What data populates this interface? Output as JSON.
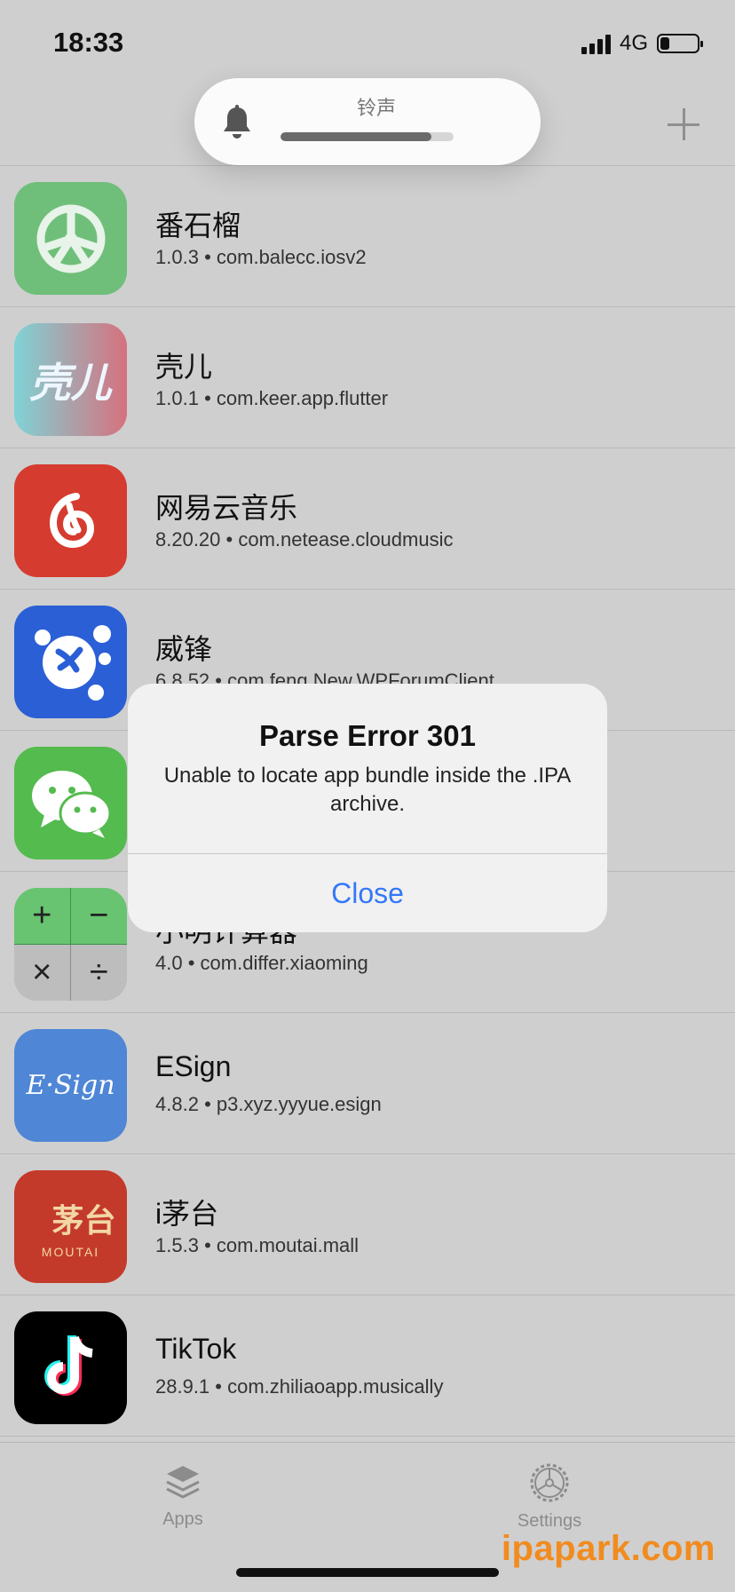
{
  "status_bar": {
    "time": "18:33",
    "network": "4G"
  },
  "ringer": {
    "label": "铃声",
    "level": 0.87
  },
  "apps": [
    {
      "name": "番石榴",
      "version": "1.0.3",
      "bundle": "com.balecc.iosv2",
      "icon": "guava-wheel-icon"
    },
    {
      "name": "壳儿",
      "version": "1.0.1",
      "bundle": "com.keer.app.flutter",
      "icon": "keer-icon",
      "icon_text": "壳儿"
    },
    {
      "name": "网易云音乐",
      "version": "8.20.20",
      "bundle": "com.netease.cloudmusic",
      "icon": "netease-music-icon"
    },
    {
      "name": "威锋",
      "version": "6.8.52",
      "bundle": "com.feng.New.WPForumClient",
      "icon": "weifeng-icon"
    },
    {
      "name": "",
      "version": "",
      "bundle": "",
      "icon": "wechat-icon"
    },
    {
      "name": "小明计算器",
      "version": "4.0",
      "bundle": "com.differ.xiaoming",
      "icon": "calculator-icon"
    },
    {
      "name": "ESign",
      "version": "4.8.2",
      "bundle": "p3.xyz.yyyue.esign",
      "icon": "esign-icon",
      "icon_text": "E·Sign"
    },
    {
      "name": "i茅台",
      "version": "1.5.3",
      "bundle": "com.moutai.mall",
      "icon": "moutai-icon",
      "icon_text": "茅台",
      "icon_subtext": "MOUTAI"
    },
    {
      "name": "TikTok",
      "version": "28.9.1",
      "bundle": "com.zhiliaoapp.musically",
      "icon": "tiktok-icon"
    }
  ],
  "separator": "•",
  "tabs": {
    "apps": "Apps",
    "settings": "Settings"
  },
  "alert": {
    "title": "Parse Error 301",
    "message": "Unable to locate app bundle inside the .IPA archive.",
    "button": "Close"
  },
  "watermark": "ipapark.com",
  "colors": {
    "accent": "#3478f6",
    "watermark": "#f28b1f"
  }
}
